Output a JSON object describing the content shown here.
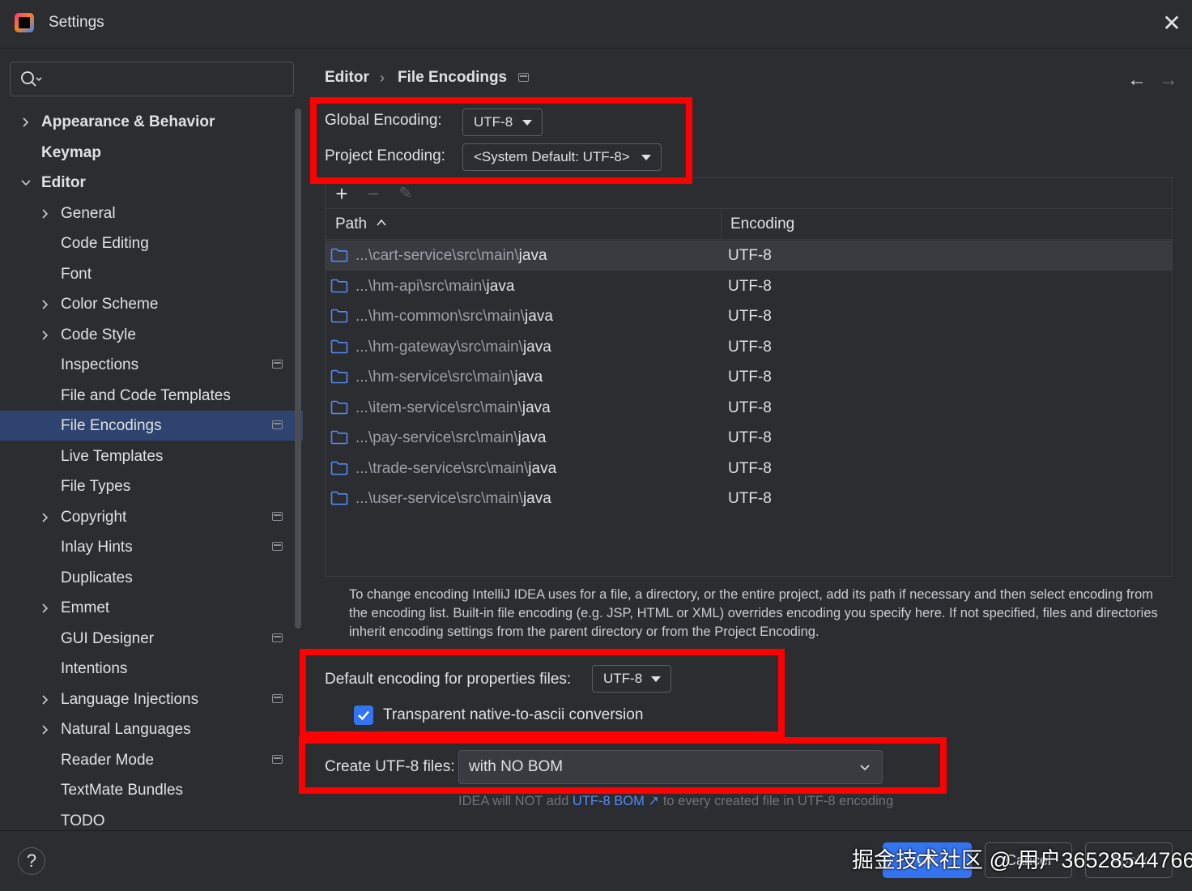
{
  "window": {
    "title": "Settings",
    "close_glyph": "✕"
  },
  "search": {
    "placeholder": ""
  },
  "sidebar": {
    "items": [
      {
        "label": "Appearance & Behavior",
        "level": 0,
        "bold": true,
        "expandable": true,
        "expanded": false,
        "project_icon": false
      },
      {
        "label": "Keymap",
        "level": 0,
        "bold": true,
        "expandable": false,
        "project_icon": false
      },
      {
        "label": "Editor",
        "level": 0,
        "bold": true,
        "expandable": true,
        "expanded": true,
        "project_icon": false
      },
      {
        "label": "General",
        "level": 1,
        "expandable": true,
        "project_icon": false
      },
      {
        "label": "Code Editing",
        "level": 1,
        "expandable": false,
        "project_icon": false
      },
      {
        "label": "Font",
        "level": 1,
        "expandable": false,
        "project_icon": false
      },
      {
        "label": "Color Scheme",
        "level": 1,
        "expandable": true,
        "project_icon": false
      },
      {
        "label": "Code Style",
        "level": 1,
        "expandable": true,
        "project_icon": false
      },
      {
        "label": "Inspections",
        "level": 1,
        "expandable": false,
        "project_icon": true
      },
      {
        "label": "File and Code Templates",
        "level": 1,
        "expandable": false,
        "project_icon": false
      },
      {
        "label": "File Encodings",
        "level": 1,
        "expandable": false,
        "project_icon": true,
        "selected": true
      },
      {
        "label": "Live Templates",
        "level": 1,
        "expandable": false,
        "project_icon": false
      },
      {
        "label": "File Types",
        "level": 1,
        "expandable": false,
        "project_icon": false
      },
      {
        "label": "Copyright",
        "level": 1,
        "expandable": true,
        "project_icon": true
      },
      {
        "label": "Inlay Hints",
        "level": 1,
        "expandable": false,
        "project_icon": true
      },
      {
        "label": "Duplicates",
        "level": 1,
        "expandable": false,
        "project_icon": false
      },
      {
        "label": "Emmet",
        "level": 1,
        "expandable": true,
        "project_icon": false
      },
      {
        "label": "GUI Designer",
        "level": 1,
        "expandable": false,
        "project_icon": true
      },
      {
        "label": "Intentions",
        "level": 1,
        "expandable": false,
        "project_icon": false
      },
      {
        "label": "Language Injections",
        "level": 1,
        "expandable": true,
        "project_icon": true
      },
      {
        "label": "Natural Languages",
        "level": 1,
        "expandable": true,
        "project_icon": false
      },
      {
        "label": "Reader Mode",
        "level": 1,
        "expandable": false,
        "project_icon": true
      },
      {
        "label": "TextMate Bundles",
        "level": 1,
        "expandable": false,
        "project_icon": false
      },
      {
        "label": "TODO",
        "level": 1,
        "expandable": false,
        "project_icon": false
      }
    ]
  },
  "breadcrumb": {
    "parent": "Editor",
    "separator": "›",
    "current": "File Encodings"
  },
  "nav": {
    "back": "←",
    "forward": "→"
  },
  "encodings": {
    "global_label": "Global Encoding:",
    "global_value": "UTF-8",
    "project_label": "Project Encoding:",
    "project_value": "<System Default: UTF-8>"
  },
  "table": {
    "toolbar": {
      "add": "+",
      "remove": "−",
      "edit": "✎"
    },
    "columns": [
      "Path",
      "Encoding"
    ],
    "rows": [
      {
        "path_prefix": "...\\cart-service\\src\\main\\",
        "path_tail": "java",
        "encoding": "UTF-8",
        "selected": true
      },
      {
        "path_prefix": "...\\hm-api\\src\\main\\",
        "path_tail": "java",
        "encoding": "UTF-8"
      },
      {
        "path_prefix": "...\\hm-common\\src\\main\\",
        "path_tail": "java",
        "encoding": "UTF-8"
      },
      {
        "path_prefix": "...\\hm-gateway\\src\\main\\",
        "path_tail": "java",
        "encoding": "UTF-8"
      },
      {
        "path_prefix": "...\\hm-service\\src\\main\\",
        "path_tail": "java",
        "encoding": "UTF-8"
      },
      {
        "path_prefix": "...\\item-service\\src\\main\\",
        "path_tail": "java",
        "encoding": "UTF-8"
      },
      {
        "path_prefix": "...\\pay-service\\src\\main\\",
        "path_tail": "java",
        "encoding": "UTF-8"
      },
      {
        "path_prefix": "...\\trade-service\\src\\main\\",
        "path_tail": "java",
        "encoding": "UTF-8"
      },
      {
        "path_prefix": "...\\user-service\\src\\main\\",
        "path_tail": "java",
        "encoding": "UTF-8"
      }
    ]
  },
  "help_text": "To change encoding IntelliJ IDEA uses for a file, a directory, or the entire project, add its path if necessary and then select encoding from the encoding list. Built-in file encoding (e.g. JSP, HTML or XML) overrides encoding you specify here. If not specified, files and directories inherit encoding settings from the parent directory or from the Project Encoding.",
  "properties": {
    "label": "Default encoding for properties files:",
    "value": "UTF-8",
    "checkbox_label": "Transparent native-to-ascii conversion",
    "checked": true
  },
  "bom": {
    "label": "Create UTF-8 files:",
    "value": "with NO BOM",
    "hint_prefix": "IDEA will NOT add ",
    "hint_link": "UTF-8 BOM ↗",
    "hint_suffix": " to every created file in UTF-8 encoding"
  },
  "footer": {
    "help": "?",
    "ok": "OK",
    "cancel": "Cancel",
    "apply": "Apply",
    "watermark": "掘金技术社区 @ 用户36528544766"
  },
  "colors": {
    "background": "#2b2d30",
    "selection": "#2e436e",
    "accent": "#3574f0",
    "highlight_box": "#ff0000",
    "link": "#548af7"
  }
}
